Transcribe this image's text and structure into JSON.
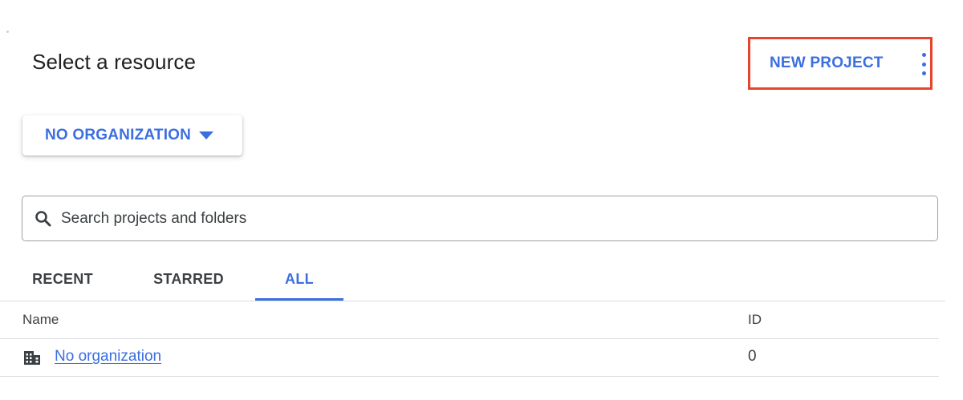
{
  "header": {
    "title": "Select a resource",
    "new_project_label": "NEW PROJECT",
    "more_icon": "more-vert-icon"
  },
  "org_selector": {
    "label": "NO ORGANIZATION",
    "icon": "arrow-drop-down-icon"
  },
  "search": {
    "placeholder": "Search projects and folders",
    "value": "",
    "icon": "search-icon"
  },
  "tabs": [
    {
      "label": "RECENT",
      "active": false
    },
    {
      "label": "STARRED",
      "active": false
    },
    {
      "label": "ALL",
      "active": true
    }
  ],
  "table": {
    "columns": [
      "Name",
      "ID"
    ],
    "rows": [
      {
        "icon": "organization-building-icon",
        "name": "No organization",
        "id": "0"
      }
    ]
  },
  "colors": {
    "accent": "#3b6fe0",
    "highlight_border": "#e8442d",
    "divider": "#dadce0"
  }
}
